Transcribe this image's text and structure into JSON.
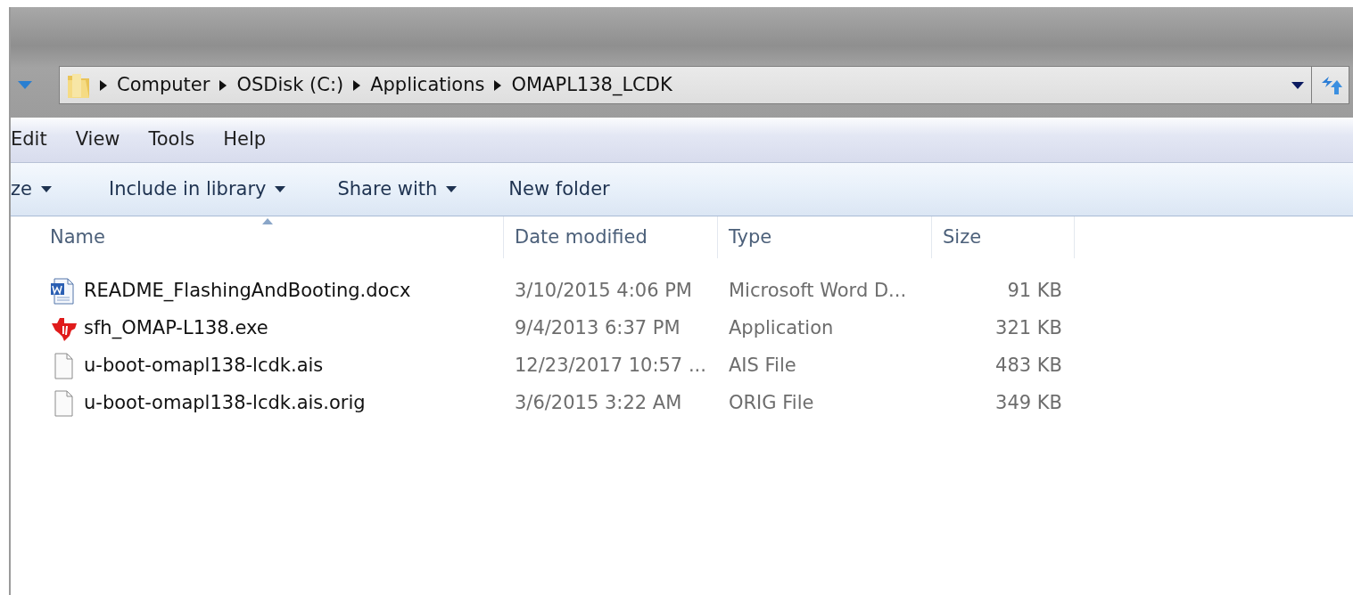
{
  "address_bar": {
    "breadcrumbs": [
      "Computer",
      "OSDisk (C:)",
      "Applications",
      "OMAPL138_LCDK"
    ]
  },
  "menu_bar": [
    "Edit",
    "View",
    "Tools",
    "Help"
  ],
  "toolbar": [
    {
      "label": "ze",
      "dropdown": true
    },
    {
      "label": "Include in library",
      "dropdown": true
    },
    {
      "label": "Share with",
      "dropdown": true
    },
    {
      "label": "New folder",
      "dropdown": false
    }
  ],
  "columns": [
    {
      "label": "Name",
      "sorted": true
    },
    {
      "label": "Date modified",
      "sorted": false
    },
    {
      "label": "Type",
      "sorted": false
    },
    {
      "label": "Size",
      "sorted": false
    }
  ],
  "files": [
    {
      "kind": "word",
      "name": "README_FlashingAndBooting.docx",
      "date": "3/10/2015 4:06 PM",
      "type": "Microsoft Word D...",
      "size": "91 KB"
    },
    {
      "kind": "app",
      "name": "sfh_OMAP-L138.exe",
      "date": "9/4/2013 6:37 PM",
      "type": "Application",
      "size": "321 KB"
    },
    {
      "kind": "file",
      "name": "u-boot-omapl138-lcdk.ais",
      "date": "12/23/2017 10:57 ...",
      "type": "AIS File",
      "size": "483 KB"
    },
    {
      "kind": "file",
      "name": "u-boot-omapl138-lcdk.ais.orig",
      "date": "3/6/2015 3:22 AM",
      "type": "ORIG File",
      "size": "349 KB"
    }
  ]
}
